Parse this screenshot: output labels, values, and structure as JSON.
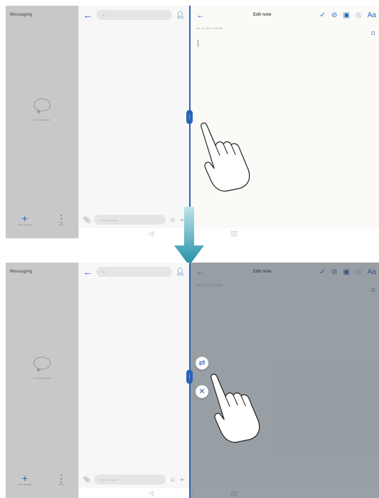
{
  "messaging": {
    "title": "Messaging",
    "empty_text": "No conversations",
    "new_label": "New message",
    "more_label": "More"
  },
  "conversation": {
    "to_placeholder": "To",
    "input_placeholder": "Type message"
  },
  "notes": {
    "title": "Edit note",
    "timestamp": "Dec 13, 2017 11:30 AM",
    "font_label": "Aa"
  },
  "icons": {
    "back": "arrow-left-icon",
    "contact": "person-icon",
    "attach": "paperclip-icon",
    "emoji": "emoji-icon",
    "send": "send-icon",
    "confirm": "check-icon",
    "checklist": "check-circle-icon",
    "image": "image-icon",
    "camera": "camera-icon",
    "bookmark": "bookmark-icon",
    "swap": "swap-icon",
    "close": "close-icon"
  },
  "colors": {
    "accent": "#2a64b7",
    "sidebar": "#c8c8c8",
    "overlay": "#3c4858"
  }
}
